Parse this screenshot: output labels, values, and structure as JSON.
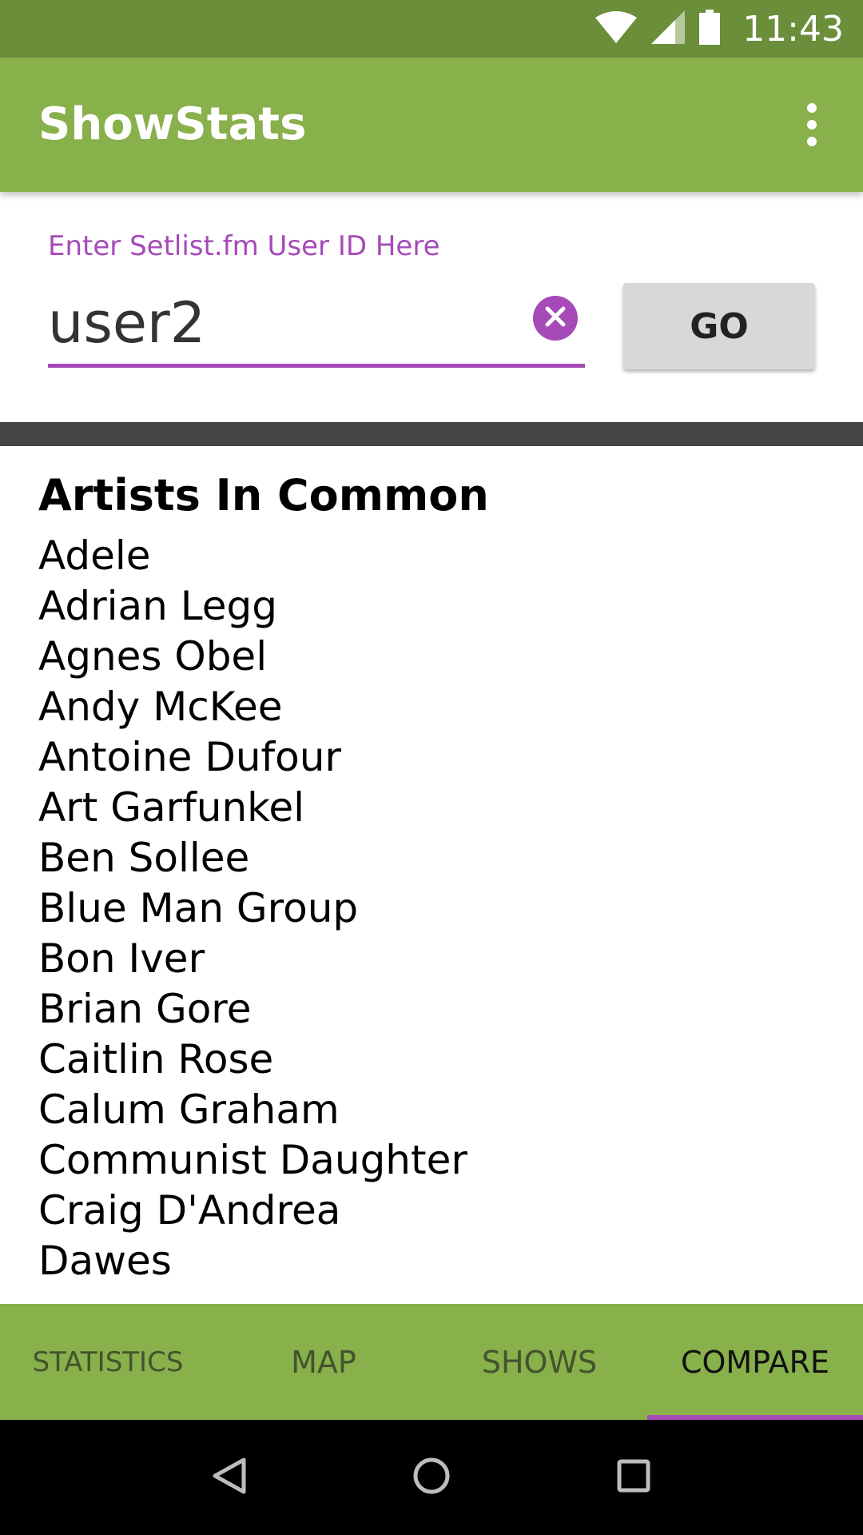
{
  "status_bar": {
    "time": "11:43",
    "icons": [
      "wifi-icon",
      "signal-icon",
      "battery-icon"
    ]
  },
  "app_bar": {
    "title": "ShowStats",
    "menu_icon": "more-vert-icon"
  },
  "user_input": {
    "label": "Enter Setlist.fm User ID Here",
    "value": "user2",
    "clear_icon": "clear-icon",
    "go_label": "GO"
  },
  "compare": {
    "section_title": "Artists In Common",
    "artists": [
      "Adele",
      "Adrian Legg",
      "Agnes Obel",
      "Andy McKee",
      "Antoine Dufour",
      "Art Garfunkel",
      "Ben Sollee",
      "Blue Man Group",
      "Bon Iver",
      "Brian Gore",
      "Caitlin Rose",
      "Calum Graham",
      "Communist Daughter",
      "Craig D'Andrea",
      "Dawes"
    ]
  },
  "tabs": [
    {
      "label": "STATISTICS",
      "active": false
    },
    {
      "label": "MAP",
      "active": false
    },
    {
      "label": "SHOWS",
      "active": false
    },
    {
      "label": "COMPARE",
      "active": true
    }
  ],
  "nav_bar": {
    "icons": [
      "back-icon",
      "home-icon",
      "recents-icon"
    ]
  },
  "colors": {
    "status_bar": "#6b8e3a",
    "primary": "#88b04b",
    "accent": "#a64ab8",
    "divider": "#454545"
  }
}
